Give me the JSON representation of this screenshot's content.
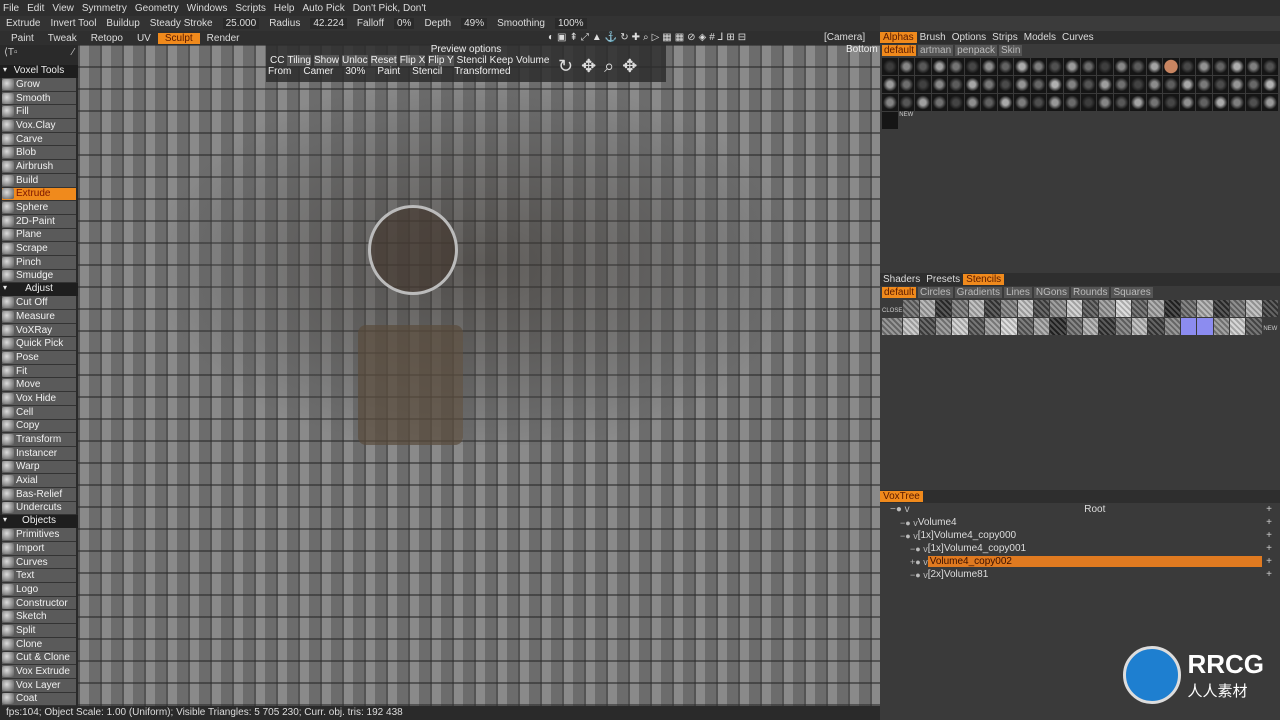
{
  "menu": [
    "File",
    "Edit",
    "View",
    "Symmetry",
    "Geometry",
    "Windows",
    "Scripts",
    "Help",
    "Auto Pick",
    "Don't Pick, Don't"
  ],
  "toolbar": {
    "tool": "Extrude",
    "invert": "Invert Tool",
    "buildup": "Buildup",
    "steady": "Steady Stroke",
    "steady_val": "25.000",
    "radius": "Radius",
    "radius_val": "42.224",
    "falloff": "Falloff",
    "falloff_val": "0%",
    "depth": "Depth",
    "depth_val": "49%",
    "smoothing": "Smoothing",
    "smoothing_val": "100%"
  },
  "rooms": [
    "Paint",
    "Tweak",
    "Retopo",
    "UV",
    "Sculpt",
    "Render"
  ],
  "active_room": "Sculpt",
  "camera": {
    "label": "[Camera]",
    "view": "Bottom"
  },
  "preview": {
    "title": "Preview options",
    "row1": [
      "CC",
      "Tiling",
      "Show",
      "Unloc",
      "Reset",
      "Flip  X",
      "Flip  Y",
      "Stencil",
      "Keep",
      "Volume"
    ],
    "row2": [
      "From",
      "Camer",
      "30%",
      "Paint",
      "Stencil",
      "Transformed"
    ]
  },
  "left": {
    "sections": [
      {
        "title": "Voxel Tools",
        "items": [
          "Grow",
          "Smooth",
          "Fill",
          "Vox.Clay",
          "Carve",
          "Blob",
          "Airbrush",
          "Build",
          "Extrude",
          "Sphere",
          "2D-Paint",
          "Plane",
          "Scrape",
          "Pinch",
          "Smudge"
        ]
      },
      {
        "title": "Adjust",
        "items": [
          "Cut Off",
          "Measure",
          "VoXRay",
          "Quick Pick",
          "Pose",
          "Fit",
          "Move",
          "Vox Hide",
          "Cell",
          "Copy",
          "Transform",
          "Instancer",
          "Warp",
          "Axial",
          "Bas-Relief",
          "Undercuts"
        ]
      },
      {
        "title": "Objects",
        "items": [
          "Primitives",
          "Import",
          "Curves",
          "Text",
          "Logo",
          "Constructor",
          "Sketch",
          "Split",
          "Clone",
          "Cut & Clone",
          "Vox Extrude",
          "Vox Layer",
          "Coat"
        ]
      }
    ],
    "selected": "Extrude"
  },
  "status": "fps:104;   Object Scale: 1.00 (Uniform); Visible Triangles: 5 705 230; Curr. obj. tris: 192 438",
  "alphas": {
    "tabs": [
      "Alphas",
      "Brush",
      "Options",
      "Strips",
      "Models",
      "Curves"
    ],
    "sets": [
      "default",
      "artman",
      "penpack",
      "Skin"
    ],
    "new_label": "NEW"
  },
  "stencils": {
    "tabs": [
      "Shaders",
      "Presets",
      "Stencils"
    ],
    "sets": [
      "default",
      "Circles",
      "Gradients",
      "Lines",
      "NGons",
      "Rounds",
      "Squares"
    ],
    "close_label": "CLOSE",
    "new_label": "NEW"
  },
  "voxtree": {
    "title": "VoxTree",
    "root": "Root",
    "items": [
      "Volume4",
      "[1x]Volume4_copy000",
      "[1x]Volume4_copy001",
      "Volume4_copy002",
      "[2x]Volume81"
    ],
    "selected": "Volume4_copy002"
  },
  "watermark": {
    "brand": "RRCG",
    "sub": "人人素材"
  },
  "colors": {
    "accent": "#f08a1c"
  }
}
